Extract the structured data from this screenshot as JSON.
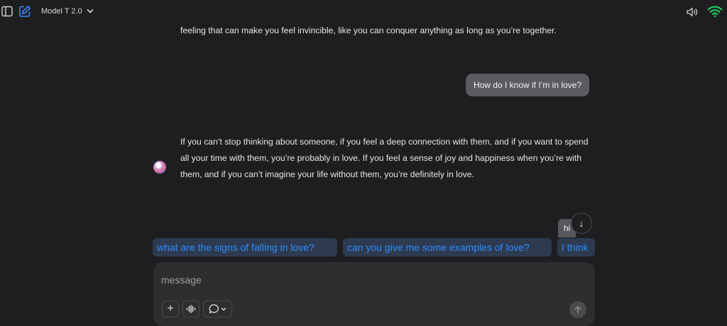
{
  "header": {
    "model_name": "Model T 2.0",
    "icons": [
      "sidebar-toggle-icon",
      "new-chat-icon",
      "chevron-down-icon",
      "speaker-icon",
      "wifi-icon"
    ],
    "wifi_color": "#22c55e",
    "accent_color": "#2f8cff"
  },
  "messages": [
    {
      "role": "assistant",
      "text": "feeling that can make you feel invincible, like you can conquer anything as long as you’re together."
    },
    {
      "role": "user",
      "text": "How do I know if I’m in love?"
    },
    {
      "role": "assistant",
      "text": "If you can’t stop thinking about someone, if you feel a deep connection with them, and if you want to spend all your time with them, you’re probably in love. If you feel a sense of joy and happiness when you’re with them, and if you can’t imagine your life without them, you’re definitely in love."
    }
  ],
  "hi_chip": "hi",
  "scroll_down_symbol": "↓",
  "suggestions": [
    "what are the signs of falling in love?",
    "can you give me some examples of love?",
    "I think"
  ],
  "composer": {
    "placeholder": "message",
    "plus_symbol": "+",
    "tools": [
      "add-icon",
      "voice-wave-icon",
      "chat-bubble-icon",
      "chevron-down-icon",
      "send-arrow-icon"
    ]
  }
}
